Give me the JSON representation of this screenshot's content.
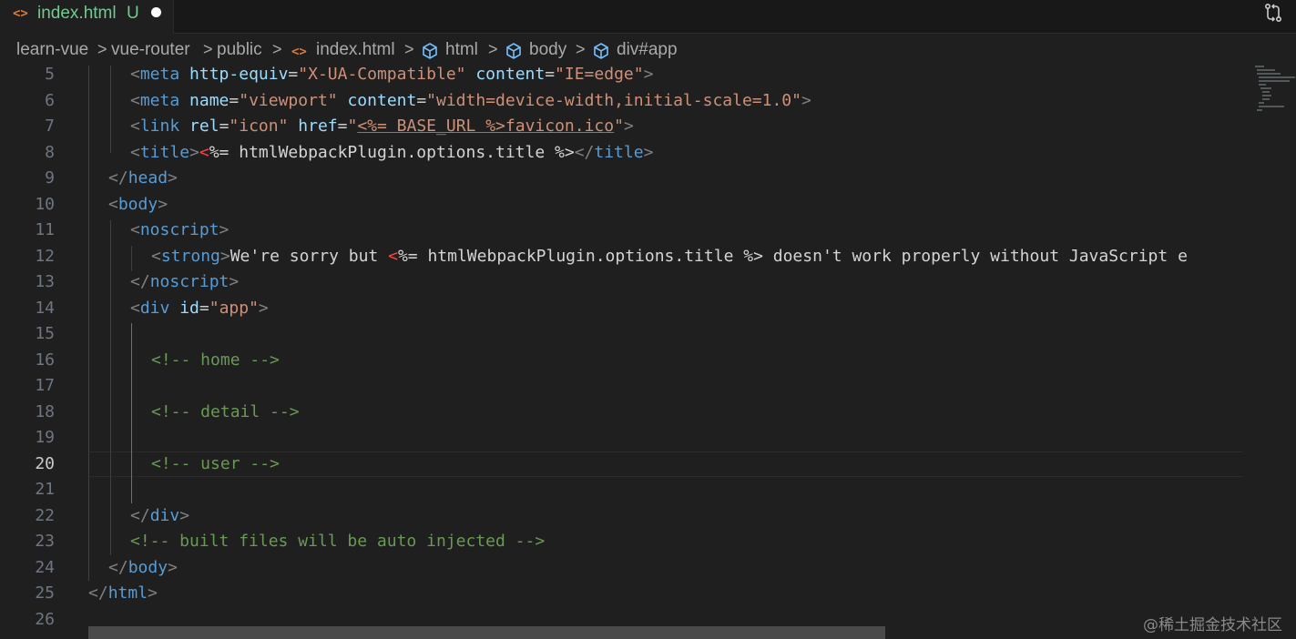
{
  "tab": {
    "icon": "<>",
    "filename": "index.html",
    "status": "U",
    "modified_indicator": "dot"
  },
  "breadcrumb": {
    "items": [
      "learn-vue",
      "vue-router",
      "public",
      "index.html",
      "html",
      "body",
      "div#app"
    ],
    "separator": ">"
  },
  "editor": {
    "active_line": "20",
    "line_numbers": [
      "5",
      "6",
      "7",
      "8",
      "9",
      "10",
      "11",
      "12",
      "13",
      "14",
      "15",
      "16",
      "17",
      "18",
      "19",
      "20",
      "21",
      "22",
      "23",
      "24",
      "25",
      "26"
    ],
    "code": {
      "l5": {
        "open": "<",
        "tag": "meta",
        "a1": "http-equiv",
        "v1": "\"X-UA-Compatible\"",
        "a2": "content",
        "v2": "\"IE=edge\"",
        "close": ">"
      },
      "l6": {
        "open": "<",
        "tag": "meta",
        "a1": "name",
        "v1": "\"viewport\"",
        "a2": "content",
        "v2": "\"width=device-width,initial-scale=1.0\"",
        "close": ">"
      },
      "l7": {
        "open": "<",
        "tag": "link",
        "a1": "rel",
        "v1": "\"icon\"",
        "a2": "href",
        "q_open": "\"",
        "err": "<%= BASE_URL %>",
        "v2": "favicon.ico",
        "q_close": "\"",
        "close": ">"
      },
      "l8": {
        "open": "<",
        "tag": "title",
        "close": ">",
        "err": "<",
        "text": "%= htmlWebpackPlugin.options.title %>",
        "end_open": "</",
        "end_tag": "title",
        "end_close": ">"
      },
      "l9": {
        "open": "</",
        "tag": "head",
        "close": ">"
      },
      "l10": {
        "open": "<",
        "tag": "body",
        "close": ">"
      },
      "l11": {
        "open": "<",
        "tag": "noscript",
        "close": ">"
      },
      "l12": {
        "open": "<",
        "tag": "strong",
        "close": ">",
        "text1": "We're sorry but ",
        "err": "<",
        "text2": "%= htmlWebpackPlugin.options.title %> doesn't work properly without JavaScript e"
      },
      "l13": {
        "open": "</",
        "tag": "noscript",
        "close": ">"
      },
      "l14": {
        "open": "<",
        "tag": "div",
        "a1": "id",
        "v1": "\"app\"",
        "close": ">"
      },
      "l16": {
        "comment": "<!-- home -->"
      },
      "l18": {
        "comment": "<!-- detail -->"
      },
      "l20": {
        "comment": "<!-- user -->"
      },
      "l22": {
        "open": "</",
        "tag": "div",
        "close": ">"
      },
      "l23": {
        "comment": "<!-- built files will be auto injected -->"
      },
      "l24": {
        "open": "</",
        "tag": "body",
        "close": ">"
      },
      "l25": {
        "open": "</",
        "tag": "html",
        "close": ">"
      }
    }
  },
  "icons": {
    "tab_file": "html-file-icon",
    "compare": "compare-changes-icon",
    "breadcrumb_symbol": "element-cube-icon"
  },
  "colors": {
    "background": "#1f1f1f",
    "tab_bar": "#181818",
    "untracked_green": "#73c991",
    "html_icon_orange": "#e37933",
    "tag_blue": "#569cd6",
    "attr_lightblue": "#9cdcfe",
    "string_orange": "#ce9178",
    "comment_green": "#6a9955",
    "error_red": "#f44747"
  },
  "watermark": "@稀土掘金技术社区"
}
